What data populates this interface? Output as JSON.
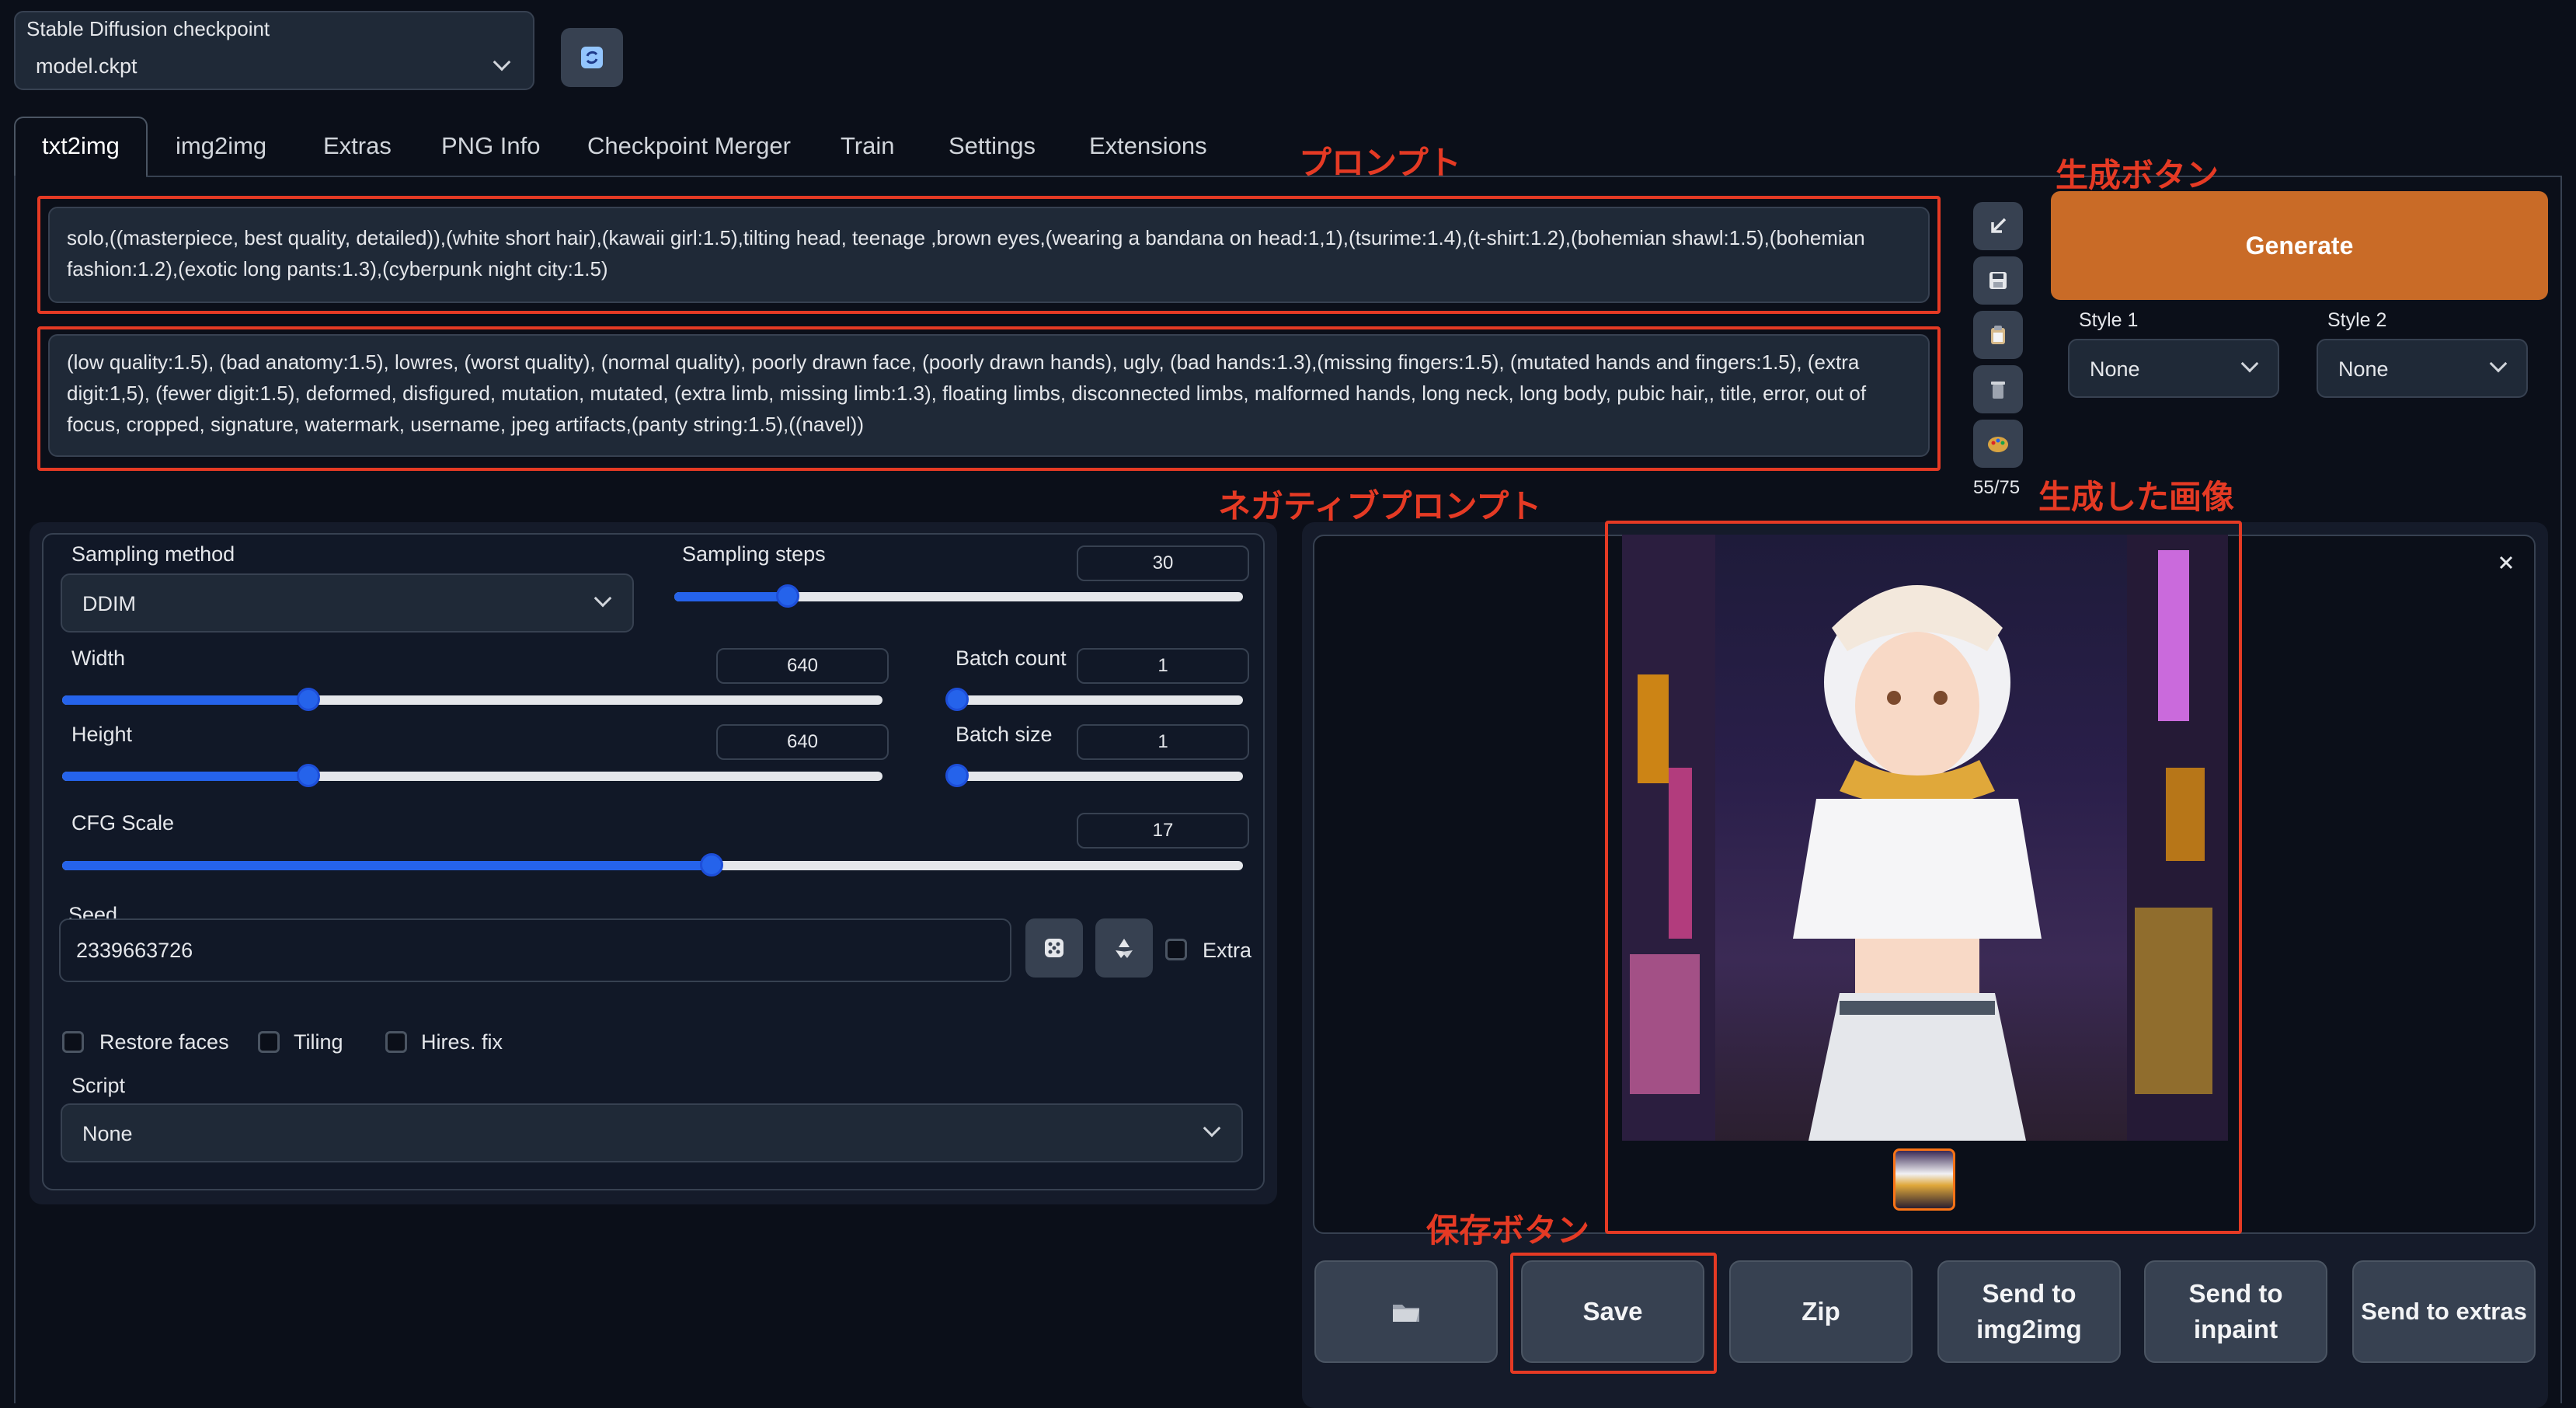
{
  "checkpoint": {
    "label": "Stable Diffusion checkpoint",
    "value": "model.ckpt"
  },
  "tabs": [
    "txt2img",
    "img2img",
    "Extras",
    "PNG Info",
    "Checkpoint Merger",
    "Train",
    "Settings",
    "Extensions"
  ],
  "active_tab": "txt2img",
  "prompt": "solo,((masterpiece, best quality, detailed)),(white short hair),(kawaii girl:1.5),tilting head, teenage ,brown eyes,(wearing a bandana on head:1,1),(tsurime:1.4),(t-shirt:1.2),(bohemian shawl:1.5),(bohemian fashion:1.2),(exotic long pants:1.3),(cyberpunk night city:1.5)",
  "negative_prompt": "(low quality:1.5), (bad anatomy:1.5), lowres, (worst quality),  (normal quality), poorly drawn face, (poorly drawn hands), ugly, (bad hands:1.3),(missing fingers:1.5), (mutated hands and fingers:1.5), (extra digit:1,5), (fewer digit:1.5), deformed, disfigured, mutation, mutated, (extra limb, missing limb:1.3), floating limbs, disconnected limbs, malformed hands, long neck, long body, pubic hair,, title, error, out of focus, cropped, signature, watermark, username, jpeg artifacts,(panty string:1.5),((navel))",
  "token_count": "55/75",
  "generate_label": "Generate",
  "style1": {
    "label": "Style 1",
    "value": "None"
  },
  "style2": {
    "label": "Style 2",
    "value": "None"
  },
  "sampling_method": {
    "label": "Sampling method",
    "value": "DDIM"
  },
  "sampling_steps": {
    "label": "Sampling steps",
    "value": "30",
    "fraction": 0.2
  },
  "width": {
    "label": "Width",
    "value": "640",
    "fraction": 0.3
  },
  "height": {
    "label": "Height",
    "value": "640",
    "fraction": 0.3
  },
  "batch_count": {
    "label": "Batch count",
    "value": "1",
    "fraction": 0.0
  },
  "batch_size": {
    "label": "Batch size",
    "value": "1",
    "fraction": 0.0
  },
  "cfg_scale": {
    "label": "CFG Scale",
    "value": "17",
    "fraction": 0.55
  },
  "seed": {
    "label": "Seed",
    "value": "2339663726",
    "extra_label": "Extra"
  },
  "checkboxes": {
    "restore_faces": "Restore faces",
    "tiling": "Tiling",
    "hires_fix": "Hires. fix"
  },
  "script": {
    "label": "Script",
    "value": "None"
  },
  "actions": {
    "save": "Save",
    "zip": "Zip",
    "send_img2img": [
      "Send to",
      "img2img"
    ],
    "send_inpaint": [
      "Send to",
      "inpaint"
    ],
    "send_extras": "Send to extras"
  },
  "annotations": {
    "prompt": "プロンプト",
    "generate": "生成ボタン",
    "negative": "ネガティブプロンプト",
    "image": "生成した画像",
    "save": "保存ボタン"
  },
  "colors": {
    "accent": "#2563eb",
    "generate": "#c96b27",
    "annotation": "#e53a24",
    "background": "#0b0f19"
  },
  "icons": [
    "refresh-icon",
    "arrow-icon",
    "save-icon",
    "paste-icon",
    "trash-icon",
    "palette-icon",
    "dice-icon",
    "recycle-icon",
    "folder-icon",
    "close-icon"
  ]
}
